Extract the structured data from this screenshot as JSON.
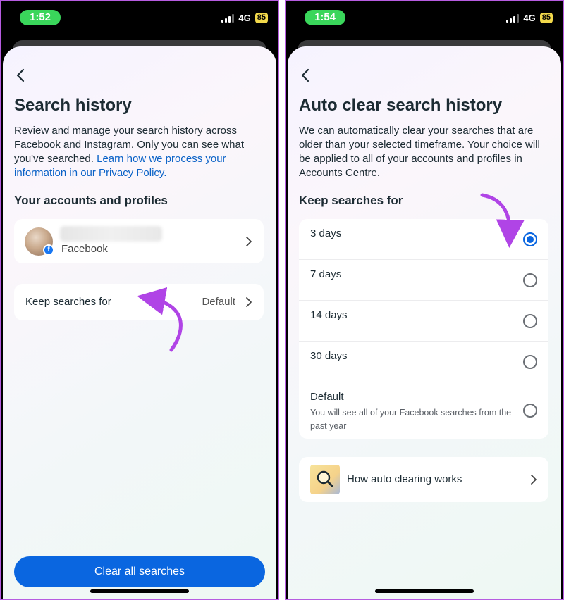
{
  "left": {
    "status": {
      "time": "1:52",
      "network": "4G",
      "battery": "85"
    },
    "title": "Search history",
    "description": "Review and manage your search history across Facebook and Instagram. Only you can see what you've searched. ",
    "privacy_link": "Learn how we process your information in our Privacy Policy.",
    "accounts_header": "Your accounts and profiles",
    "account": {
      "platform": "Facebook"
    },
    "keep_searches": {
      "label": "Keep searches for",
      "value": "Default"
    },
    "clear_button": "Clear all searches"
  },
  "right": {
    "status": {
      "time": "1:54",
      "network": "4G",
      "battery": "85"
    },
    "title": "Auto clear search history",
    "description": "We can automatically clear your searches that are older than your selected timeframe. Your choice will be applied to all of your accounts and profiles in Accounts Centre.",
    "keep_header": "Keep searches for",
    "options": [
      {
        "label": "3 days",
        "sub": "",
        "checked": true
      },
      {
        "label": "7 days",
        "sub": "",
        "checked": false
      },
      {
        "label": "14 days",
        "sub": "",
        "checked": false
      },
      {
        "label": "30 days",
        "sub": "",
        "checked": false
      },
      {
        "label": "Default",
        "sub": "You will see all of your Facebook searches from the past year",
        "checked": false
      }
    ],
    "how_link": "How auto clearing works"
  },
  "colors": {
    "accent": "#0a66e0",
    "annotation_arrow": "#b044e6",
    "link": "#0a62c7"
  },
  "icons": [
    "back-arrow-icon",
    "chevron-right-icon",
    "facebook-icon",
    "search-magnifier-icon",
    "signal-icon",
    "battery-icon"
  ]
}
